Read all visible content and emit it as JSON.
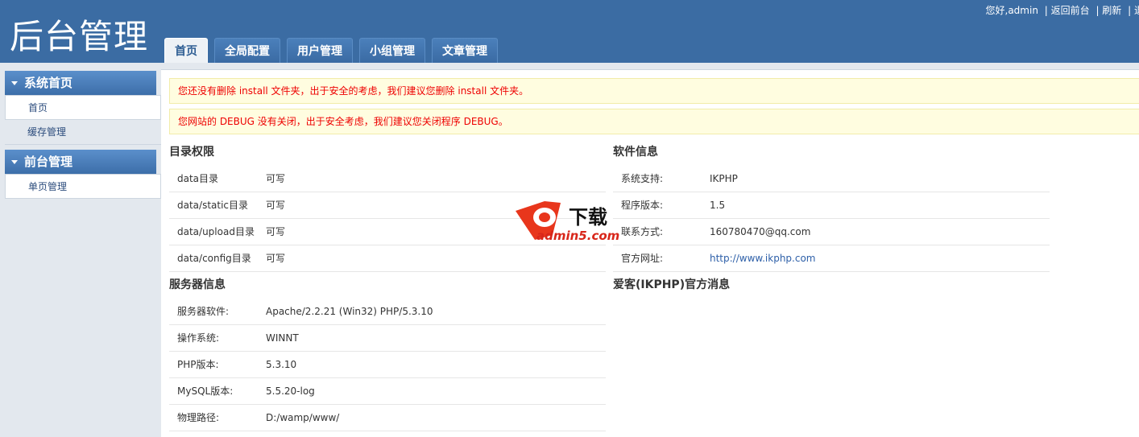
{
  "header": {
    "title": "后台管理",
    "greeting": "您好,admin",
    "links": [
      "| 返回前台",
      "| 刷新",
      "| 退"
    ]
  },
  "tabs": [
    "首页",
    "全局配置",
    "用户管理",
    "小组管理",
    "文章管理"
  ],
  "sidebar": [
    {
      "title": "系统首页",
      "items": [
        "首页",
        "缓存管理"
      ]
    },
    {
      "title": "前台管理",
      "items": [
        "单页管理"
      ]
    }
  ],
  "alerts": [
    "您还没有删除 install 文件夹，出于安全的考虑，我们建议您删除 install 文件夹。",
    "您网站的 DEBUG 没有关闭，出于安全考虑，我们建议您关闭程序 DEBUG。"
  ],
  "dirs": {
    "title": "目录权限",
    "rows": [
      [
        "data目录",
        "可写"
      ],
      [
        "data/static目录",
        "可写"
      ],
      [
        "data/upload目录",
        "可写"
      ],
      [
        "data/config目录",
        "可写"
      ]
    ]
  },
  "server": {
    "title": "服务器信息",
    "rows": [
      [
        "服务器软件:",
        "Apache/2.2.21 (Win32) PHP/5.3.10"
      ],
      [
        "操作系统:",
        "WINNT"
      ],
      [
        "PHP版本:",
        "5.3.10"
      ],
      [
        "MySQL版本:",
        "5.5.20-log"
      ],
      [
        "物理路径:",
        "D:/wamp/www/"
      ]
    ]
  },
  "software": {
    "title": "软件信息",
    "rows": [
      [
        "系统支持:",
        "IKPHP"
      ],
      [
        "程序版本:",
        "1.5"
      ],
      [
        "联系方式:",
        "160780470@qq.com"
      ],
      [
        "官方网址:",
        "http://www.ikphp.com"
      ]
    ]
  },
  "news": {
    "title": "爱客(IKPHP)官方消息"
  },
  "watermark": {
    "brand": "下载",
    "site": "admin5.com"
  }
}
